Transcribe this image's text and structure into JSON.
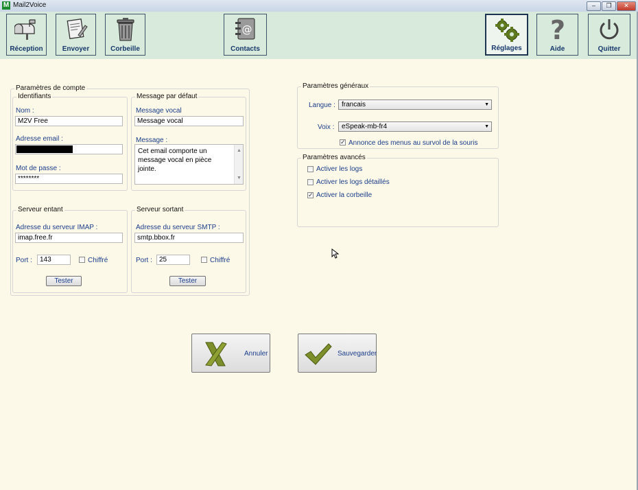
{
  "window": {
    "title": "Mail2Voice",
    "logo": "M"
  },
  "window_controls": {
    "minimize": "–",
    "restore": "❐",
    "close": "✕"
  },
  "toolbar": {
    "reception": "Réception",
    "envoyer": "Envoyer",
    "corbeille": "Corbeille",
    "contacts": "Contacts",
    "reglages": "Réglages",
    "aide": "Aide",
    "quitter": "Quitter"
  },
  "account": {
    "title": "Paramètres de compte",
    "identifiants": {
      "title": "Identifiants",
      "nom_label": "Nom :",
      "nom_value": "M2V Free",
      "email_label": "Adresse email :",
      "email_value": "",
      "password_label": "Mot de passe :",
      "password_value": "********"
    },
    "default_message": {
      "title": "Message par défaut",
      "vocal_label": "Message vocal",
      "vocal_value": "Message vocal",
      "message_label": "Message :",
      "message_value": "Cet email comporte un message vocal en pièce jointe."
    },
    "incoming": {
      "title": "Serveur entant",
      "address_label": "Adresse du serveur IMAP :",
      "address_value": "imap.free.fr",
      "port_label": "Port :",
      "port_value": "143",
      "encrypted_label": "Chiffré",
      "encrypted": false,
      "test_label": "Tester"
    },
    "outgoing": {
      "title": "Serveur sortant",
      "address_label": "Adresse du serveur SMTP :",
      "address_value": "smtp.bbox.fr",
      "port_label": "Port :",
      "port_value": "25",
      "encrypted_label": "Chiffré",
      "encrypted": false,
      "test_label": "Tester"
    }
  },
  "general": {
    "title": "Paramètres généraux",
    "langue_label": "Langue :",
    "langue_value": "francais",
    "voix_label": "Voix :",
    "voix_value": "eSpeak-mb-fr4",
    "announce_label": "Annonce des menus au survol de la souris",
    "announce": true
  },
  "advanced": {
    "title": "Paramètres avancés",
    "logs_label": "Activer les logs",
    "logs": false,
    "detailed_logs_label": "Activer les logs détaillés",
    "detailed_logs": false,
    "trash_label": "Activer la corbeille",
    "trash": true
  },
  "actions": {
    "cancel": "Annuler",
    "save": "Sauvegarder"
  },
  "colors": {
    "toolbar_bg": "#d7eadb",
    "page_bg": "#fdf9e8",
    "label_blue": "#1a3d8a",
    "nav_text": "#17386b"
  }
}
